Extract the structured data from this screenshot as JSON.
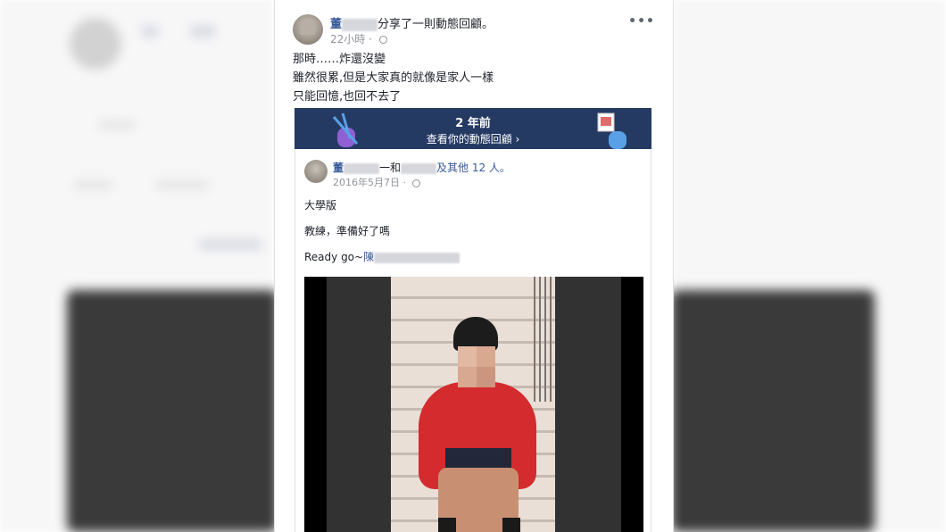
{
  "post": {
    "author_suffix": "分享了一則動態回顧。",
    "author_name": "董",
    "time": "22小時",
    "text_lines": [
      "那時……炸還沒變",
      "雖然很累,但是大家真的就像是家人一樣",
      "只能回憶,也回不去了"
    ]
  },
  "memory": {
    "years": "2 年前",
    "link": "查看你的動態回顧 ›"
  },
  "shared": {
    "author_name": "董",
    "with_text": "一和",
    "others": "及其他 12 人。",
    "date": "2016年5月7日 ·",
    "lines": [
      "大學版",
      "教練，準備好了嗎",
      "Ready go~"
    ],
    "tag_name": "陳"
  },
  "icons": {
    "more": "more-icon",
    "privacy": "globe-icon"
  }
}
